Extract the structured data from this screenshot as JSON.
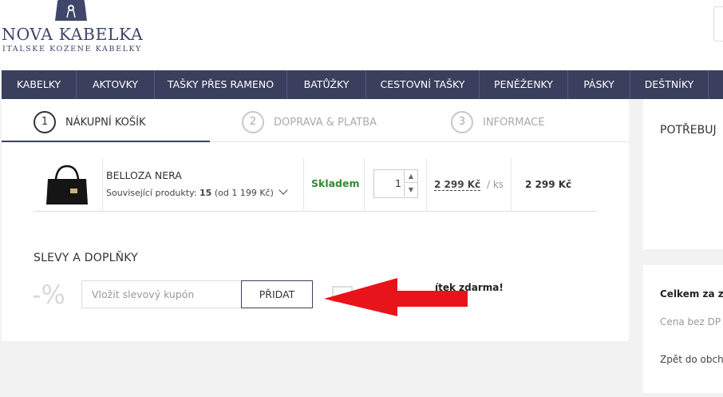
{
  "brand": {
    "name": "NOVA KABELKA",
    "tagline": "ITALSKE KOZENE KABELKY",
    "color": "#3f4669"
  },
  "nav": {
    "items": [
      "KABELKY",
      "AKTOVKY",
      "TAŠKY PŘES RAMENO",
      "BATŮŽKY",
      "CESTOVNÍ TAŠKY",
      "PENĚŽENKY",
      "PÁSKY",
      "DEŠTNÍKY"
    ],
    "background": "#3b3f5e"
  },
  "steps": [
    {
      "num": "1",
      "label": "NÁKUPNÍ KOŠÍK",
      "active": true
    },
    {
      "num": "2",
      "label": "DOPRAVA & PLATBA",
      "active": false
    },
    {
      "num": "3",
      "label": "INFORMACE",
      "active": false
    }
  ],
  "cart": {
    "item": {
      "name": "BELLOZA NERA",
      "related_label": "Související produkty:",
      "related_count": "15",
      "related_from": "(od 1 199 Kč)",
      "stock": "Skladem",
      "quantity": "1",
      "unit_price": "2 299 Kč",
      "unit_suffix": "/ ks",
      "total": "2 299 Kč",
      "image_icon": "black-handbag"
    }
  },
  "discounts": {
    "title": "SLEVY A DOPLŇKY",
    "percent_icon": "-%",
    "coupon_placeholder": "Vložit slevový kupón",
    "add_button": "PŘIDAT",
    "promo_text": "ítek zdarma!"
  },
  "sidebar": {
    "help_title": "POTŘEBUJ",
    "summary_title": "Celkem za zb",
    "price_no_vat": "Cena bez DP",
    "back_link": "Zpět do obcho"
  },
  "annotation": {
    "arrow_color": "#e8141c"
  }
}
